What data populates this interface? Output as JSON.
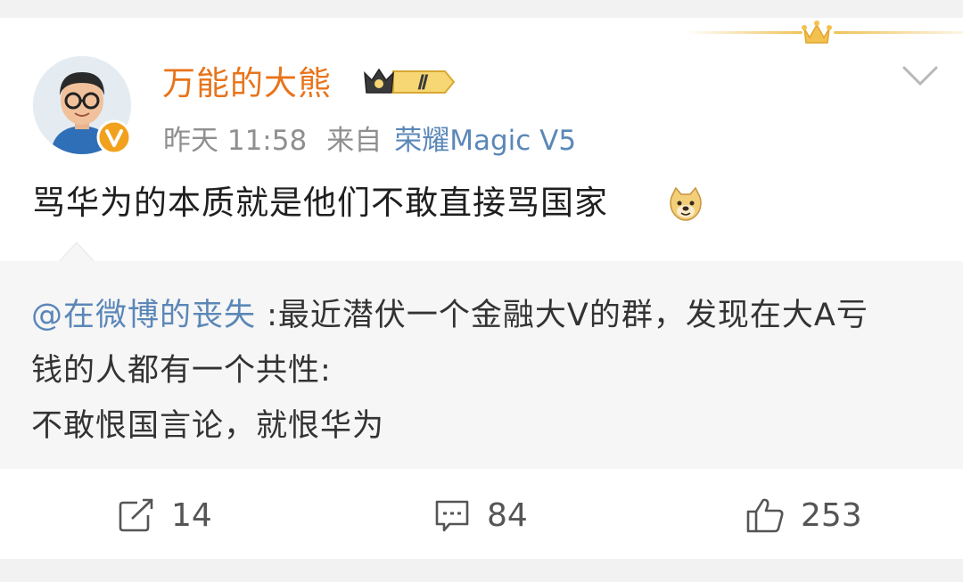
{
  "post": {
    "author": "万能的大熊",
    "level_badge": "Ⅱ",
    "time": "昨天 11:58",
    "source_prefix": "来自",
    "source_device": "荣耀Magic V5",
    "text": "骂华为的本质就是他们不敢直接骂国家"
  },
  "quote": {
    "mention": "@在微博的丧失",
    "line1": " :最近潜伏一个金融大V的群，发现在大A亏",
    "line2": "钱的人都有一个共性:",
    "line3": "不敢恨国言论，就恨华为"
  },
  "actions": {
    "repost_count": "14",
    "comment_count": "84",
    "like_count": "253"
  },
  "colors": {
    "username": "#e8741b",
    "link": "#5b87b8",
    "meta": "#8f8f8f",
    "verified_badge": "#f2a11d"
  },
  "icons": [
    "crown-icon",
    "verified-icon",
    "chevron-down-icon",
    "doge-emoji-icon",
    "repost-icon",
    "comment-icon",
    "like-icon"
  ]
}
